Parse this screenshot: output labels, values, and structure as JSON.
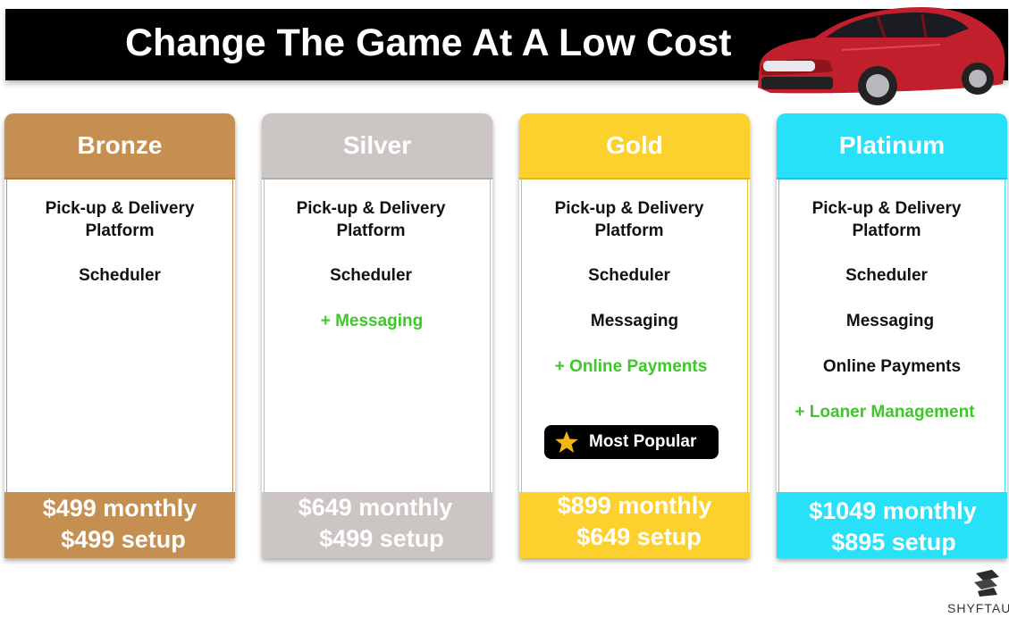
{
  "header": {
    "title": "Change The Game At A Low Cost"
  },
  "brand": {
    "name": "SHYFTAU"
  },
  "colors": {
    "bronze": "#c58f51",
    "silver": "#cbc6c4",
    "gold": "#fdd12d",
    "platinum": "#28e0f7",
    "addon_green": "#3cc827"
  },
  "plans": [
    {
      "name": "Bronze",
      "features": [
        {
          "text": "Pick-up & Delivery\nPlatform",
          "addon": false
        },
        {
          "text": "Scheduler",
          "addon": false
        }
      ],
      "monthly": "$499 monthly",
      "setup": "$499 setup"
    },
    {
      "name": "Silver",
      "features": [
        {
          "text": "Pick-up & Delivery\nPlatform",
          "addon": false
        },
        {
          "text": "Scheduler",
          "addon": false
        },
        {
          "text": "+ Messaging",
          "addon": true
        }
      ],
      "monthly": "$649 monthly",
      "setup": "$499 setup"
    },
    {
      "name": "Gold",
      "features": [
        {
          "text": "Pick-up & Delivery\nPlatform",
          "addon": false
        },
        {
          "text": "Scheduler",
          "addon": false
        },
        {
          "text": "Messaging",
          "addon": false
        },
        {
          "text": "+ Online Payments",
          "addon": true
        }
      ],
      "badge": "Most Popular",
      "monthly": "$899 monthly",
      "setup": "$649 setup"
    },
    {
      "name": "Platinum",
      "features": [
        {
          "text": "Pick-up & Delivery\nPlatform",
          "addon": false
        },
        {
          "text": "Scheduler",
          "addon": false
        },
        {
          "text": "Messaging",
          "addon": false
        },
        {
          "text": "Online Payments",
          "addon": false
        },
        {
          "text": "+ Loaner Management",
          "addon": true
        }
      ],
      "monthly": "$1049 monthly",
      "setup": "$895 setup"
    }
  ],
  "icons": {
    "badge": "star-icon",
    "hero": "red-sedan-image",
    "logo": "shyftau-logo-icon"
  }
}
